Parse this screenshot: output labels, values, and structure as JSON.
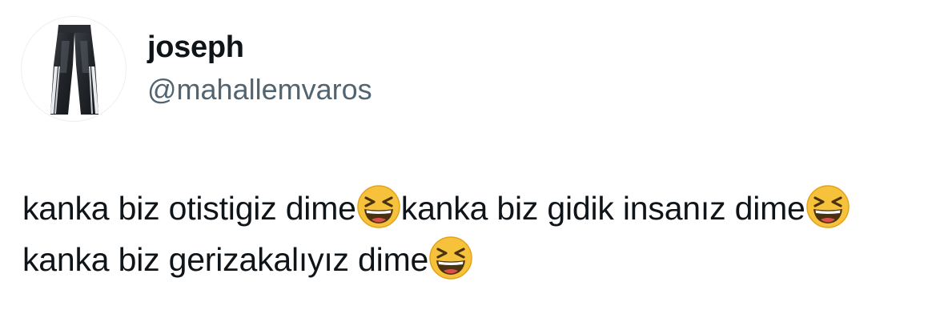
{
  "tweet": {
    "author": {
      "display_name": "joseph",
      "handle": "@mahallemvaros",
      "avatar_icon": "jeans-avatar-icon"
    },
    "text_segments": [
      "kanka biz otistigiz dime",
      "kanka biz gidik insanız dime",
      "kanka biz gerizakalıyız dime"
    ],
    "emoji": {
      "name": "grinning-squinting-face-icon",
      "face_color": "#f7c23b",
      "mouth_color": "#ffffff"
    }
  }
}
